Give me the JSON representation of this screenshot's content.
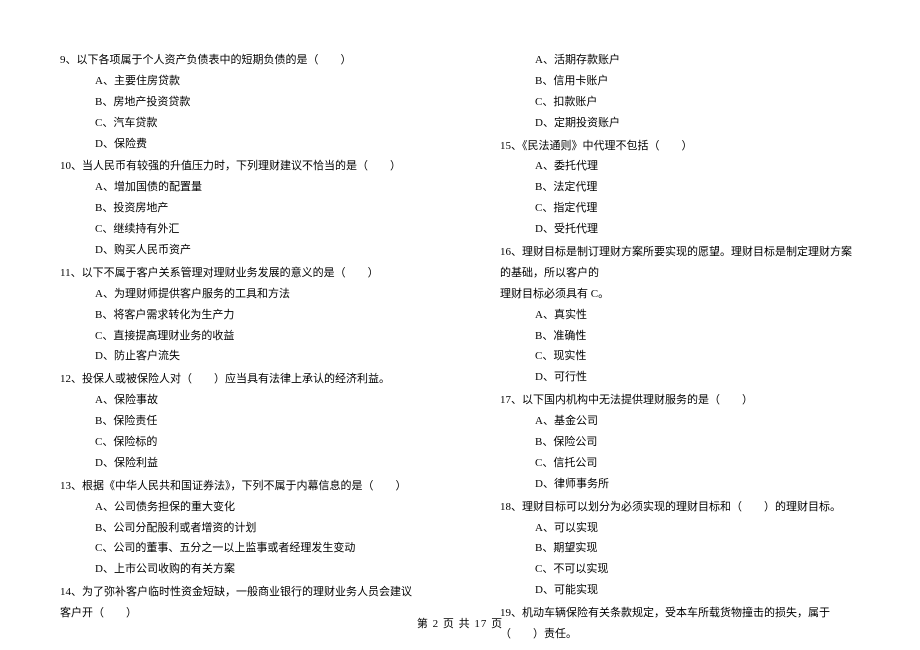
{
  "left": {
    "q9": {
      "text": "9、以下各项属于个人资产负债表中的短期负债的是（　　）",
      "A": "A、主要住房贷款",
      "B": "B、房地产投资贷款",
      "C": "C、汽车贷款",
      "D": "D、保险费"
    },
    "q10": {
      "text": "10、当人民币有较强的升值压力时，下列理财建议不恰当的是（　　）",
      "A": "A、增加国债的配置量",
      "B": "B、投资房地产",
      "C": "C、继续持有外汇",
      "D": "D、购买人民币资产"
    },
    "q11": {
      "text": "11、以下不属于客户关系管理对理财业务发展的意义的是（　　）",
      "A": "A、为理财师提供客户服务的工具和方法",
      "B": "B、将客户需求转化为生产力",
      "C": "C、直接提高理财业务的收益",
      "D": "D、防止客户流失"
    },
    "q12": {
      "text": "12、投保人或被保险人对（　　）应当具有法律上承认的经济利益。",
      "A": "A、保险事故",
      "B": "B、保险责任",
      "C": "C、保险标的",
      "D": "D、保险利益"
    },
    "q13": {
      "text": "13、根据《中华人民共和国证券法》，下列不属于内幕信息的是（　　）",
      "A": "A、公司债务担保的重大变化",
      "B": "B、公司分配股利或者增资的计划",
      "C": "C、公司的董事、五分之一以上监事或者经理发生变动",
      "D": "D、上市公司收购的有关方案"
    },
    "q14": {
      "text": "14、为了弥补客户临时性资金短缺，一般商业银行的理财业务人员会建议客户开（　　）"
    }
  },
  "right": {
    "q14opts": {
      "A": "A、活期存款账户",
      "B": "B、信用卡账户",
      "C": "C、扣款账户",
      "D": "D、定期投资账户"
    },
    "q15": {
      "text": "15、《民法通则》中代理不包括（　　）",
      "A": "A、委托代理",
      "B": "B、法定代理",
      "C": "C、指定代理",
      "D": "D、受托代理"
    },
    "q16": {
      "text1": "16、理财目标是制订理财方案所要实现的愿望。理财目标是制定理财方案的基础，所以客户的",
      "text2": "理财目标必须具有 C。",
      "A": "A、真实性",
      "B": "B、准确性",
      "C": "C、现实性",
      "D": "D、可行性"
    },
    "q17": {
      "text": "17、以下国内机构中无法提供理财服务的是（　　）",
      "A": "A、基金公司",
      "B": "B、保险公司",
      "C": "C、信托公司",
      "D": "D、律师事务所"
    },
    "q18": {
      "text": "18、理财目标可以划分为必须实现的理财目标和（　　）的理财目标。",
      "A": "A、可以实现",
      "B": "B、期望实现",
      "C": "C、不可以实现",
      "D": "D、可能实现"
    },
    "q19": {
      "text": "19、机动车辆保险有关条款规定，受本车所载货物撞击的损失，属于（　　）责任。"
    }
  },
  "footer": "第 2 页 共 17 页"
}
